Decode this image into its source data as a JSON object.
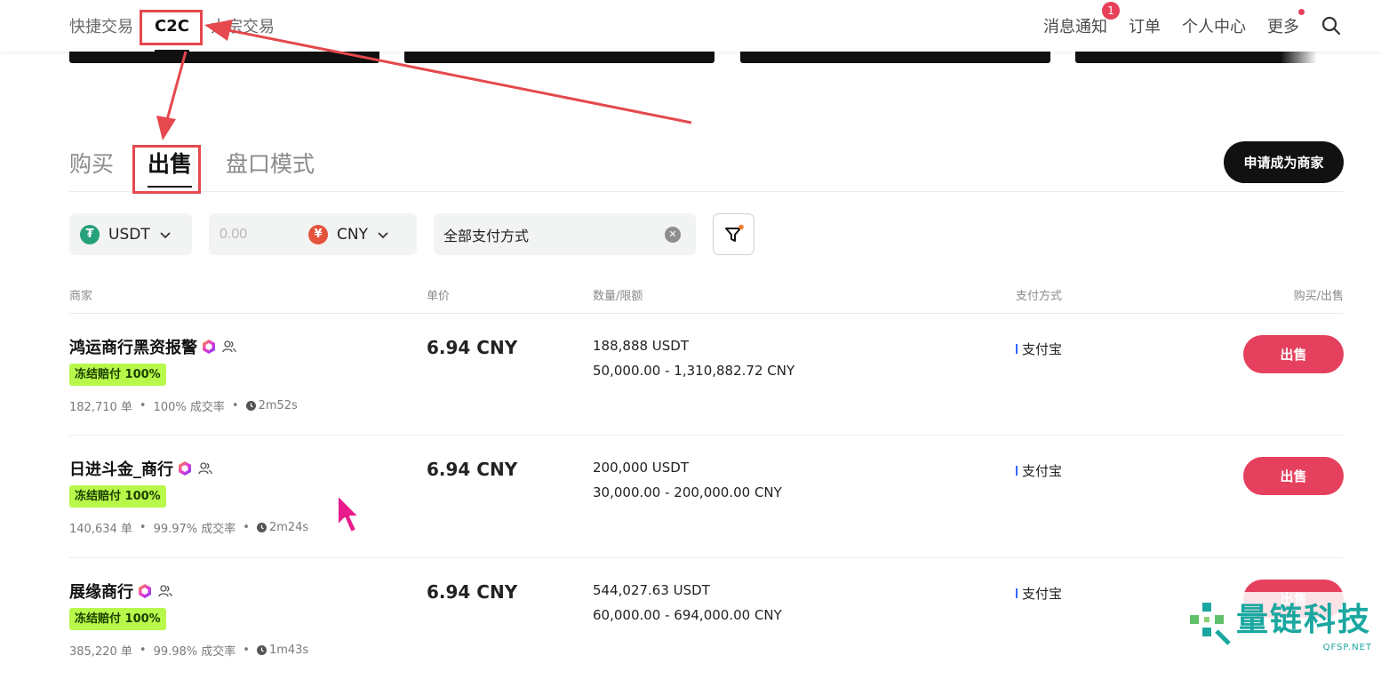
{
  "topnav": {
    "tabs": [
      "快捷交易",
      "C2C",
      "大宗交易"
    ],
    "links": {
      "notifications": "消息通知",
      "notifications_badge": "1",
      "orders": "订单",
      "profile": "个人中心",
      "more": "更多"
    }
  },
  "tabs": [
    "购买",
    "出售",
    "盘口模式"
  ],
  "merchant_button": "申请成为商家",
  "filters": {
    "coin": "USDT",
    "amount_placeholder": "0.00",
    "fiat": "CNY",
    "payment": "全部支付方式"
  },
  "table": {
    "headers": {
      "merchant": "商家",
      "price": "单价",
      "amount": "数量/限额",
      "payment": "支付方式",
      "action": "购买/出售"
    },
    "rows": [
      {
        "name": "鸿运商行黑资报警",
        "tag": "冻结赔付 100%",
        "orders": "182,710 单",
        "rate": "100% 成交率",
        "time": "2m52s",
        "price": "6.94 CNY",
        "qty": "188,888 USDT",
        "limit": "50,000.00 - 1,310,882.72 CNY",
        "payment": "支付宝",
        "action": "出售"
      },
      {
        "name": "日进斗金_商行",
        "tag": "冻结赔付 100%",
        "orders": "140,634 单",
        "rate": "99.97% 成交率",
        "time": "2m24s",
        "price": "6.94 CNY",
        "qty": "200,000 USDT",
        "limit": "30,000.00 - 200,000.00 CNY",
        "payment": "支付宝",
        "action": "出售"
      },
      {
        "name": "展缘商行",
        "tag": "冻结赔付 100%",
        "orders": "385,220 单",
        "rate": "99.98% 成交率",
        "time": "1m43s",
        "price": "6.94 CNY",
        "qty": "544,027.63 USDT",
        "limit": "60,000.00 - 694,000.00 CNY",
        "payment": "支付宝",
        "action": "出售"
      }
    ]
  },
  "watermark": {
    "text": "量链科技",
    "sub": "QFSP.NET"
  },
  "colors": {
    "accent_red": "#e5405e",
    "annotation_red": "#e5484d",
    "tag_green": "#b7f84a",
    "watermark_teal": "#1aa7a0"
  }
}
